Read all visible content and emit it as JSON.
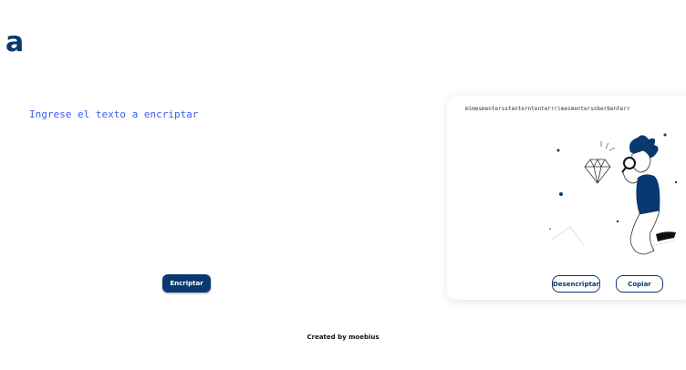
{
  "brand": {
    "logo_text": "a",
    "color": "#0A3871"
  },
  "input": {
    "placeholder": "Ingrese el texto a encriptar",
    "value": ""
  },
  "actions": {
    "encrypt_label": "Encriptar"
  },
  "output": {
    "text": "mimesmentersstenterntenterrrimesmentersoberbenterr",
    "decrypt_label": "Desencriptar",
    "copy_label": "Copiar",
    "illustration": "person-with-magnifier-and-diamond"
  },
  "footer": {
    "credit": "Created by moebius"
  },
  "colors": {
    "accent": "#0A3871",
    "input_text": "#3d5bf0"
  }
}
